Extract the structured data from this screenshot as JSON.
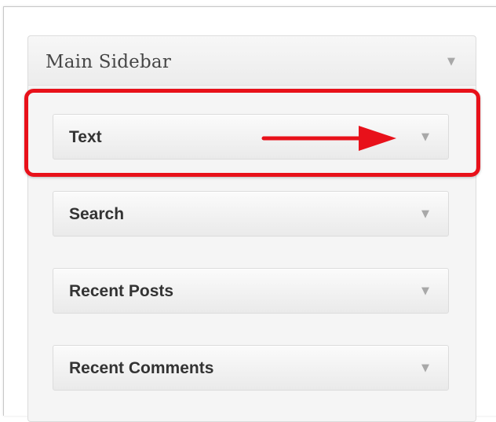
{
  "sidebar": {
    "title": "Main Sidebar",
    "widgets": [
      {
        "label": "Text",
        "highlighted": true
      },
      {
        "label": "Search"
      },
      {
        "label": "Recent Posts"
      },
      {
        "label": "Recent Comments"
      }
    ]
  },
  "icons": {
    "toggle": "chevron-down-icon",
    "annotation": "right-arrow-icon"
  },
  "colors": {
    "highlight": "#e8111a",
    "arrow": "#e8111a",
    "caret": "#a8a8a8",
    "widget_label": "#333333"
  }
}
